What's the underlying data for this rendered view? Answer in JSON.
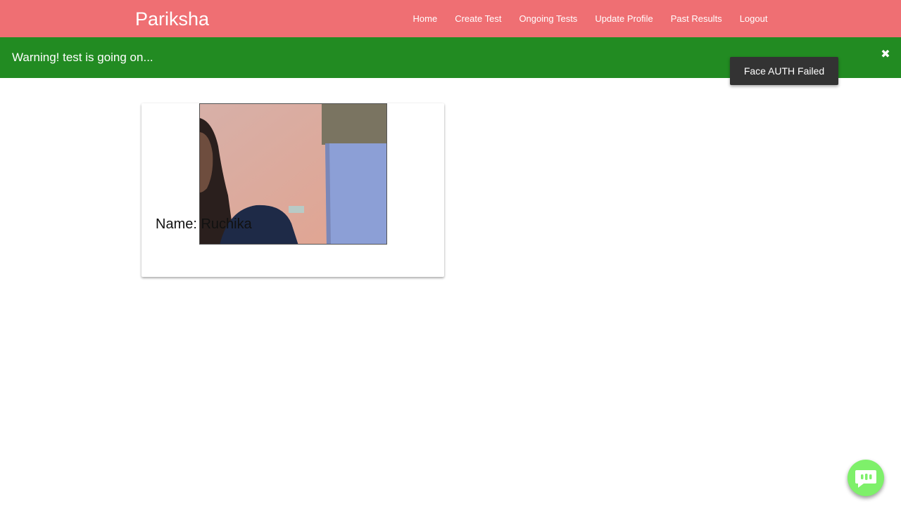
{
  "navbar": {
    "brand": "Pariksha",
    "links": [
      {
        "label": "Home"
      },
      {
        "label": "Create Test"
      },
      {
        "label": "Ongoing Tests"
      },
      {
        "label": "Update Profile"
      },
      {
        "label": "Past Results"
      },
      {
        "label": "Logout"
      }
    ],
    "color": "#ef6f73"
  },
  "alert": {
    "text": "Warning! test is going on...",
    "close_icon": "close-icon",
    "color": "#228b22"
  },
  "toast": {
    "text": "Face AUTH Failed"
  },
  "card": {
    "name_label": "Name: Ruchika",
    "camera": "webcam-feed"
  },
  "chat_button": {
    "icon": "chat-icon",
    "color": "#7ef06a"
  }
}
